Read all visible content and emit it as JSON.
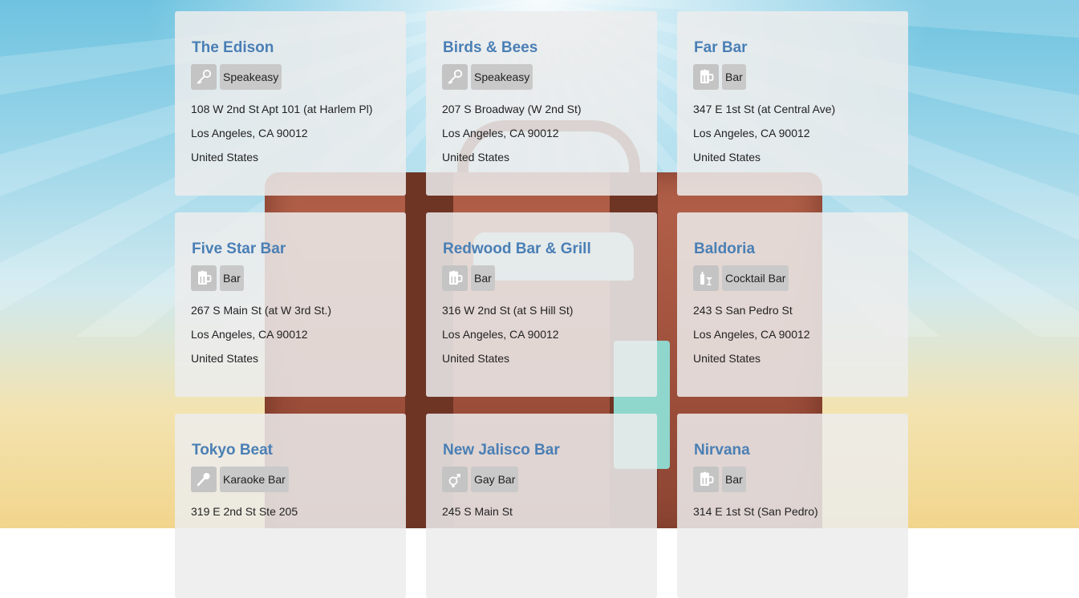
{
  "venues": [
    {
      "name": "The Edison",
      "category": "Speakeasy",
      "icon": "key-icon",
      "street": "108 W 2nd St Apt 101 (at Harlem Pl)",
      "city": "Los Angeles, CA 90012",
      "country": "United States"
    },
    {
      "name": "Birds & Bees",
      "category": "Speakeasy",
      "icon": "key-icon",
      "street": "207 S Broadway (W 2nd St)",
      "city": "Los Angeles, CA 90012",
      "country": "United States"
    },
    {
      "name": "Far Bar",
      "category": "Bar",
      "icon": "beer-mug-icon",
      "street": "347 E 1st St (at Central Ave)",
      "city": "Los Angeles, CA 90012",
      "country": "United States"
    },
    {
      "name": "Five Star Bar",
      "category": "Bar",
      "icon": "beer-mug-icon",
      "street": "267 S Main St (at W 3rd St.)",
      "city": "Los Angeles, CA 90012",
      "country": "United States"
    },
    {
      "name": "Redwood Bar & Grill",
      "category": "Bar",
      "icon": "beer-mug-icon",
      "street": "316 W 2nd St (at S Hill St)",
      "city": "Los Angeles, CA 90012",
      "country": "United States"
    },
    {
      "name": "Baldoria",
      "category": "Cocktail Bar",
      "icon": "cocktail-icon",
      "street": "243 S San Pedro St",
      "city": "Los Angeles, CA 90012",
      "country": "United States"
    },
    {
      "name": "Tokyo Beat",
      "category": "Karaoke Bar",
      "icon": "microphone-icon",
      "street": "319 E 2nd St Ste 205",
      "city": "",
      "country": ""
    },
    {
      "name": "New Jalisco Bar",
      "category": "Gay Bar",
      "icon": "gender-symbol-icon",
      "street": "245 S Main St",
      "city": "",
      "country": ""
    },
    {
      "name": "Nirvana",
      "category": "Bar",
      "icon": "beer-mug-icon",
      "street": "314 E 1st St (San Pedro)",
      "city": "",
      "country": ""
    }
  ],
  "colors": {
    "title": "#4a7fb5",
    "card_bg": "rgba(236,236,236,0.86)",
    "chip_bg": "#c9c9c9"
  }
}
